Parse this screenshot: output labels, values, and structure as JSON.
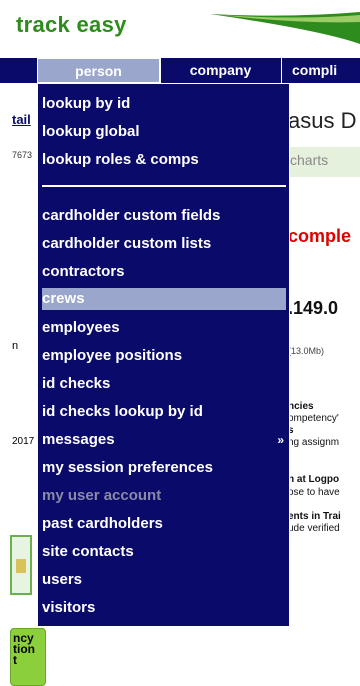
{
  "app": {
    "logo_text": "track easy"
  },
  "topnav": {
    "tabs": [
      "person",
      "company",
      "compli"
    ]
  },
  "menu": {
    "items": [
      {
        "label": "lookup by id"
      },
      {
        "label": "lookup global"
      },
      {
        "label": "lookup roles & comps"
      },
      {
        "label": "cardholder custom fields"
      },
      {
        "label": "cardholder custom lists"
      },
      {
        "label": "contractors"
      },
      {
        "label": "crews",
        "state": "highlighted"
      },
      {
        "label": "employees"
      },
      {
        "label": "employee positions"
      },
      {
        "label": "id checks"
      },
      {
        "label": "id checks lookup by id"
      },
      {
        "label": "messages",
        "has_submenu": true
      },
      {
        "label": "my session preferences"
      },
      {
        "label": "my user account",
        "state": "disabled"
      },
      {
        "label": "past cardholders"
      },
      {
        "label": "site contacts"
      },
      {
        "label": "users"
      },
      {
        "label": "visitors"
      }
    ],
    "submenu_arrow": "»"
  },
  "left_fragments": {
    "detail": "tail",
    "number": "7673",
    "n": "n",
    "year": "2017",
    "side_button": "ncy\ntion\nt"
  },
  "right_fragments": {
    "title": "asus D",
    "charts": "charts",
    "complete": "comple",
    "value": ".149.0",
    "size": "(13.0Mb)",
    "lines": [
      "ncies",
      "ompetency'",
      "s",
      "ng assignm",
      "n at Logpo",
      "ose to have",
      "ents in Trai",
      "ude verified"
    ]
  },
  "colors": {
    "nav_bg": "#0a0a6b",
    "highlight": "#9aa6cc",
    "logo_green": "#2e8b1e",
    "alert_red": "#e00000",
    "side_button_green": "#8ccf3c"
  }
}
